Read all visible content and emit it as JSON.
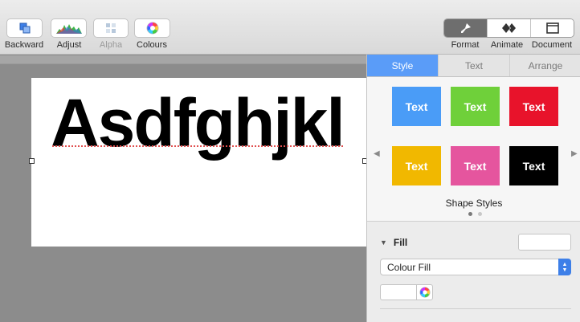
{
  "toolbar": {
    "left_buttons": [
      {
        "label": "Backward",
        "icon": "backward-icon",
        "enabled": true
      },
      {
        "label": "Adjust",
        "icon": "histogram-icon",
        "enabled": true
      },
      {
        "label": "Alpha",
        "icon": "alpha-icon",
        "enabled": false
      },
      {
        "label": "Colours",
        "icon": "color-wheel-icon",
        "enabled": true
      }
    ],
    "right_segment": [
      {
        "label": "Format",
        "icon": "paintbrush-icon",
        "active": true
      },
      {
        "label": "Animate",
        "icon": "diamonds-icon",
        "active": false
      },
      {
        "label": "Document",
        "icon": "document-icon",
        "active": false
      }
    ]
  },
  "canvas": {
    "text": "Asdfghjkl"
  },
  "sidebar": {
    "tabs": [
      {
        "label": "Style",
        "active": true
      },
      {
        "label": "Text",
        "active": false
      },
      {
        "label": "Arrange",
        "active": false
      }
    ],
    "shape_styles": {
      "label": "Shape Styles",
      "swatches": [
        {
          "label": "Text",
          "color": "#4a9cf7"
        },
        {
          "label": "Text",
          "color": "#6fd03a"
        },
        {
          "label": "Text",
          "color": "#e8132b"
        },
        {
          "label": "Text",
          "color": "#f1b800"
        },
        {
          "label": "Text",
          "color": "#e5559e"
        },
        {
          "label": "Text",
          "color": "#000000"
        }
      ],
      "page_count": 2,
      "current_page": 1
    },
    "fill": {
      "label": "Fill",
      "type": "Colour Fill"
    }
  }
}
